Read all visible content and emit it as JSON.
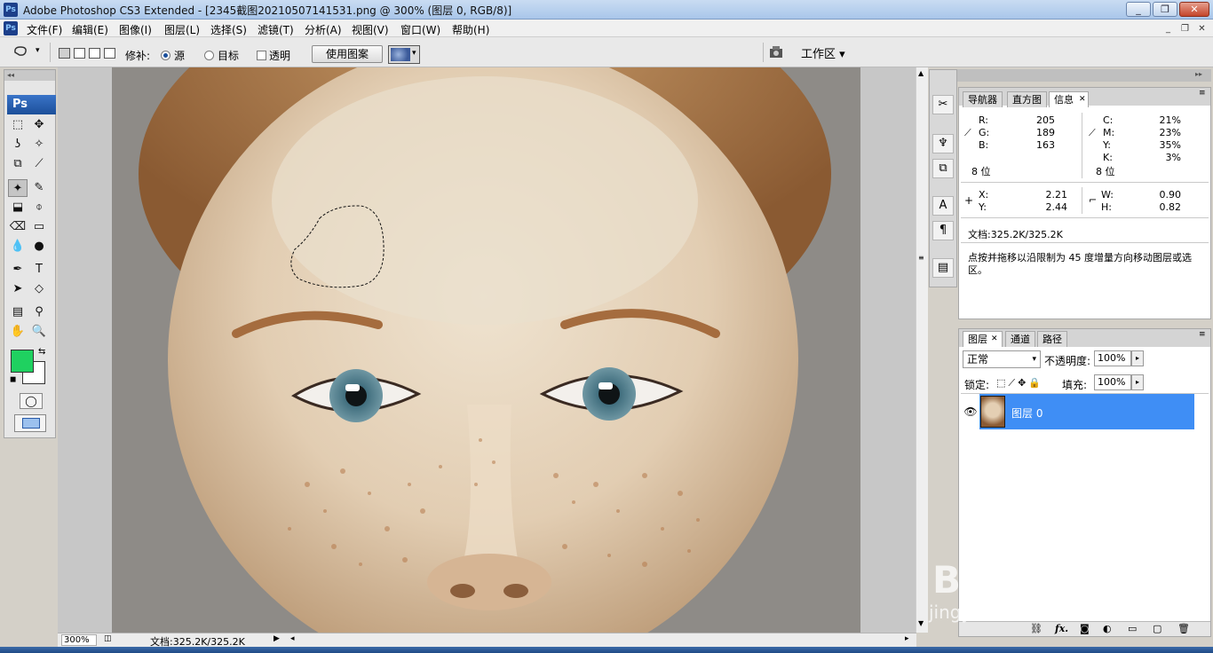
{
  "window": {
    "title": "Adobe Photoshop CS3 Extended - [2345截图20210507141531.png @ 300% (图层 0, RGB/8)]",
    "app_icon_text": "Ps",
    "controls": [
      "_",
      "❐",
      "✕"
    ]
  },
  "menu": {
    "items": [
      "文件(F)",
      "编辑(E)",
      "图像(I)",
      "图层(L)",
      "选择(S)",
      "滤镜(T)",
      "分析(A)",
      "视图(V)",
      "窗口(W)",
      "帮助(H)"
    ],
    "doc_controls": [
      "_",
      "❐",
      "✕"
    ]
  },
  "options": {
    "patch_label": "修补:",
    "source_label": "源",
    "target_label": "目标",
    "transparent_label": "透明",
    "use_pattern_label": "使用图案",
    "workspace_label": "工作区 ▾",
    "selected_mode": "源"
  },
  "toolbox": {
    "logo": "Ps",
    "tools": [
      "⬚",
      "✥",
      "ʖ",
      "✧",
      "⧉",
      "⟋",
      "✦",
      "✎",
      "⬓",
      "⌽",
      "⌫",
      "▭",
      "💧",
      "●",
      "✒",
      "T",
      "➤",
      "◇",
      "▤",
      "⚲",
      "✋",
      "🔍"
    ],
    "foreground_color": "#1fd160",
    "background_color": "#ffffff"
  },
  "status": {
    "zoom": "300%",
    "doc_size": "文档:325.2K/325.2K"
  },
  "info_panel": {
    "tabs": [
      "导航器",
      "直方图",
      "信息"
    ],
    "active_tab": "信息",
    "rgb": {
      "R": "205",
      "G": "189",
      "B": "163"
    },
    "cmyk": {
      "C": "21%",
      "M": "23%",
      "Y": "35%",
      "K": "3%"
    },
    "bit_left": "8 位",
    "bit_right": "8 位",
    "xy": {
      "X": "2.21",
      "Y": "2.44"
    },
    "wh": {
      "W": "0.90",
      "H": "0.82"
    },
    "doc": "文档:325.2K/325.2K",
    "hint": "点按并拖移以沿限制为 45 度增量方向移动图层或选区。"
  },
  "layers_panel": {
    "tabs": [
      "图层",
      "通道",
      "路径"
    ],
    "active_tab": "图层",
    "blend_mode": "正常",
    "opacity_label": "不透明度:",
    "opacity": "100%",
    "lock_label": "锁定:",
    "fill_label": "填充:",
    "fill": "100%",
    "layers": [
      {
        "name": "图层 0",
        "visible": true,
        "selected": true
      }
    ],
    "footer_icons": [
      "link-icon",
      "fx-icon",
      "mask-icon",
      "adjustment-icon",
      "group-icon",
      "new-layer-icon",
      "trash-icon"
    ],
    "fx_text": "fx."
  },
  "watermark": {
    "brand": "Baidu经验",
    "url": "jingyan.baidu.com"
  }
}
